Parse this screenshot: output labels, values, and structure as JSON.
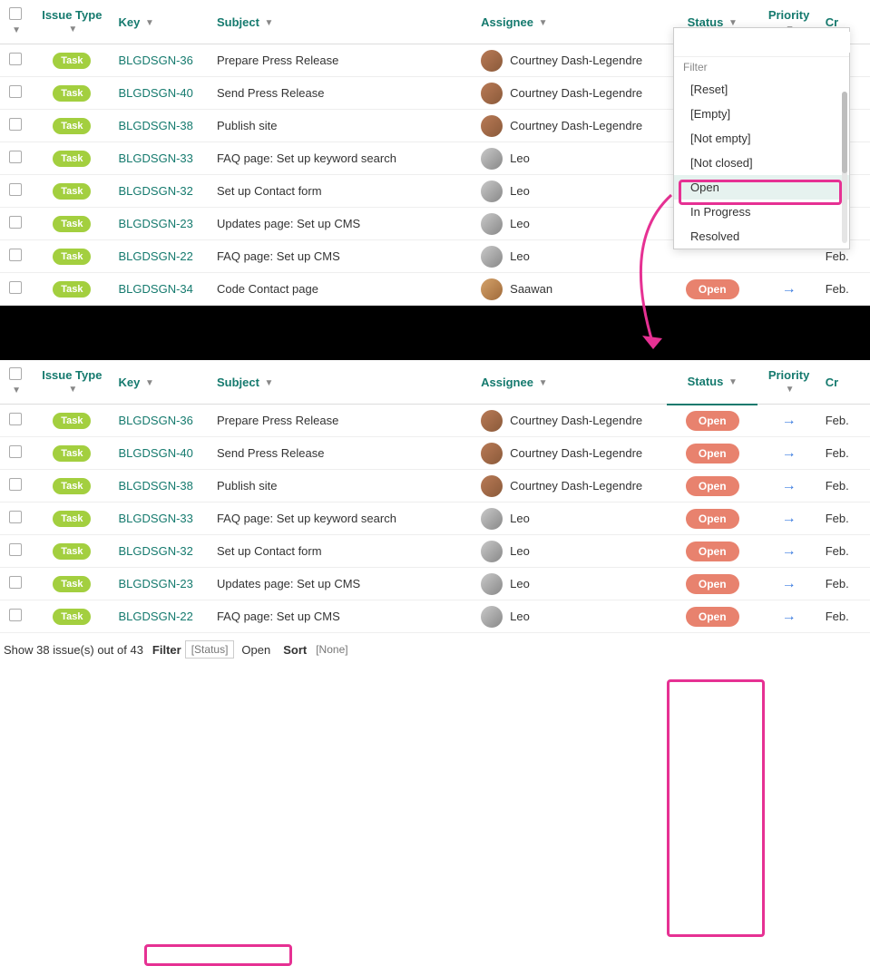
{
  "headers": {
    "issueType": "Issue Type",
    "key": "Key",
    "subject": "Subject",
    "assignee": "Assignee",
    "status": "Status",
    "priority": "Priority",
    "created": "Cr"
  },
  "badge": {
    "task": "Task"
  },
  "status": {
    "open": "Open"
  },
  "created_short": "Feb.",
  "rows1": [
    {
      "key": "BLGDSGN-36",
      "subject": "Prepare Press Release",
      "assignee": "Courtney Dash-Legendre",
      "av": "a1"
    },
    {
      "key": "BLGDSGN-40",
      "subject": "Send Press Release",
      "assignee": "Courtney Dash-Legendre",
      "av": "a1"
    },
    {
      "key": "BLGDSGN-38",
      "subject": "Publish site",
      "assignee": "Courtney Dash-Legendre",
      "av": "a1"
    },
    {
      "key": "BLGDSGN-33",
      "subject": "FAQ page: Set up keyword search",
      "assignee": "Leo",
      "av": "a2"
    },
    {
      "key": "BLGDSGN-32",
      "subject": "Set up Contact form",
      "assignee": "Leo",
      "av": "a2"
    },
    {
      "key": "BLGDSGN-23",
      "subject": "Updates page: Set up CMS",
      "assignee": "Leo",
      "av": "a2"
    },
    {
      "key": "BLGDSGN-22",
      "subject": "FAQ page: Set up CMS",
      "assignee": "Leo",
      "av": "a2"
    },
    {
      "key": "BLGDSGN-34",
      "subject": "Code Contact page",
      "assignee": "Saawan",
      "av": "a3"
    }
  ],
  "dropdown": {
    "placeholder": "",
    "filterLabel": "Filter",
    "items": [
      "[Reset]",
      "[Empty]",
      "[Not empty]",
      "[Not closed]",
      "Open",
      "In Progress",
      "Resolved"
    ],
    "selectedIndex": 4
  },
  "rows2": [
    {
      "key": "BLGDSGN-36",
      "subject": "Prepare Press Release",
      "assignee": "Courtney Dash-Legendre",
      "av": "a1"
    },
    {
      "key": "BLGDSGN-40",
      "subject": "Send Press Release",
      "assignee": "Courtney Dash-Legendre",
      "av": "a1"
    },
    {
      "key": "BLGDSGN-38",
      "subject": "Publish site",
      "assignee": "Courtney Dash-Legendre",
      "av": "a1"
    },
    {
      "key": "BLGDSGN-33",
      "subject": "FAQ page: Set up keyword search",
      "assignee": "Leo",
      "av": "a2"
    },
    {
      "key": "BLGDSGN-32",
      "subject": "Set up Contact form",
      "assignee": "Leo",
      "av": "a2"
    },
    {
      "key": "BLGDSGN-23",
      "subject": "Updates page: Set up CMS",
      "assignee": "Leo",
      "av": "a2"
    },
    {
      "key": "BLGDSGN-22",
      "subject": "FAQ page: Set up CMS",
      "assignee": "Leo",
      "av": "a2"
    }
  ],
  "footer": {
    "count": "Show 38 issue(s) out of 43",
    "filterLabel": "Filter",
    "filterField": "[Status]",
    "filterValue": "Open",
    "sortLabel": "Sort",
    "sortValue": "[None]"
  }
}
